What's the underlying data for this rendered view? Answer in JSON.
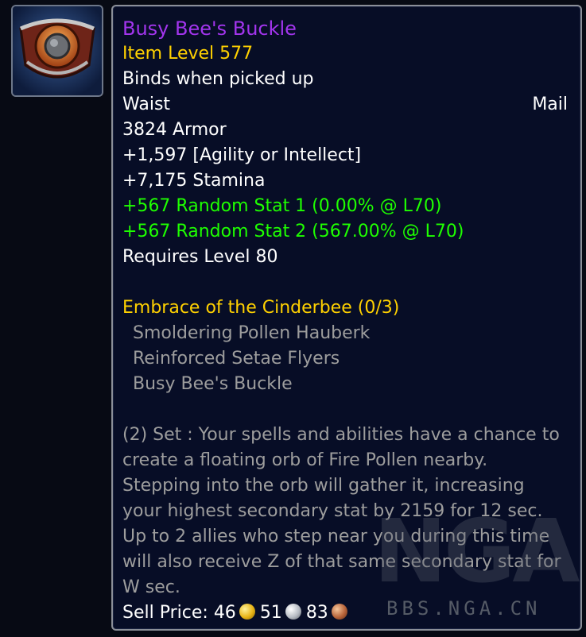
{
  "item": {
    "icon": "belt-buckle-icon",
    "name": "Busy Bee's Buckle",
    "item_level": "Item Level 577",
    "binding": "Binds when picked up",
    "slot": "Waist",
    "armor_type": "Mail",
    "armor": "3824 Armor",
    "stats": [
      "+1,597 [Agility or Intellect]",
      "+7,175 Stamina"
    ],
    "random_stats": [
      "+567 Random Stat 1 (0.00% @ L70)",
      "+567 Random Stat 2 (567.00% @ L70)"
    ],
    "requires": "Requires Level 80"
  },
  "set": {
    "title": "Embrace of the Cinderbee (0/3)",
    "items": [
      "Smoldering Pollen Hauberk",
      "Reinforced Setae Flyers",
      "Busy Bee's Buckle"
    ],
    "bonus": "(2) Set : Your spells and abilities have a chance to create a floating orb of Fire Pollen nearby. Stepping into the orb will gather it, increasing your highest secondary stat by 2159 for 12 sec. Up to 2 allies who step near you during this time will also receive Z of that same secondary stat for W sec."
  },
  "sell_price": {
    "label": "Sell Price:",
    "gold": "46",
    "silver": "51",
    "copper": "83"
  },
  "watermark": {
    "logo": "NGA",
    "url": "BBS.NGA.CN"
  },
  "colors": {
    "epic": "#a335ee",
    "item_level": "#ffd100",
    "bonus_stat": "#1eff00",
    "set_title": "#ffd100",
    "set_text": "#9d9d9d"
  }
}
